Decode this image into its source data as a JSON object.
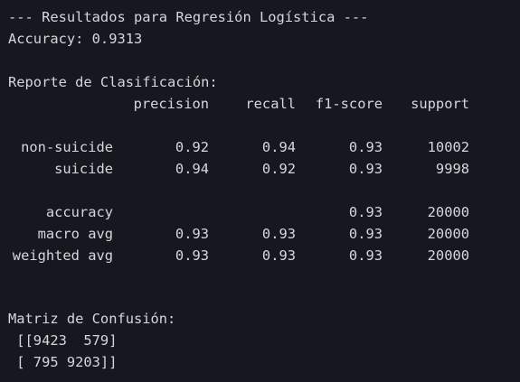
{
  "header": "--- Resultados para Regresión Logística ---",
  "accuracy_line": "Accuracy: 0.9313",
  "report": {
    "title": "Reporte de Clasificación:",
    "columns": [
      "precision",
      "recall",
      "f1-score",
      "support"
    ],
    "rows": [
      {
        "label": "non-suicide",
        "precision": "0.92",
        "recall": "0.94",
        "f1": "0.93",
        "support": "10002"
      },
      {
        "label": "suicide",
        "precision": "0.94",
        "recall": "0.92",
        "f1": "0.93",
        "support": "9998"
      }
    ],
    "summary": [
      {
        "label": "accuracy",
        "precision": "",
        "recall": "",
        "f1": "0.93",
        "support": "20000"
      },
      {
        "label": "macro avg",
        "precision": "0.93",
        "recall": "0.93",
        "f1": "0.93",
        "support": "20000"
      },
      {
        "label": "weighted avg",
        "precision": "0.93",
        "recall": "0.93",
        "f1": "0.93",
        "support": "20000"
      }
    ]
  },
  "confusion": {
    "title": "Matriz de Confusión:",
    "lines": [
      " [[9423  579]",
      " [ 795 9203]]"
    ]
  },
  "colors": {
    "background": "#15181e",
    "text": "#d4d7dc"
  }
}
